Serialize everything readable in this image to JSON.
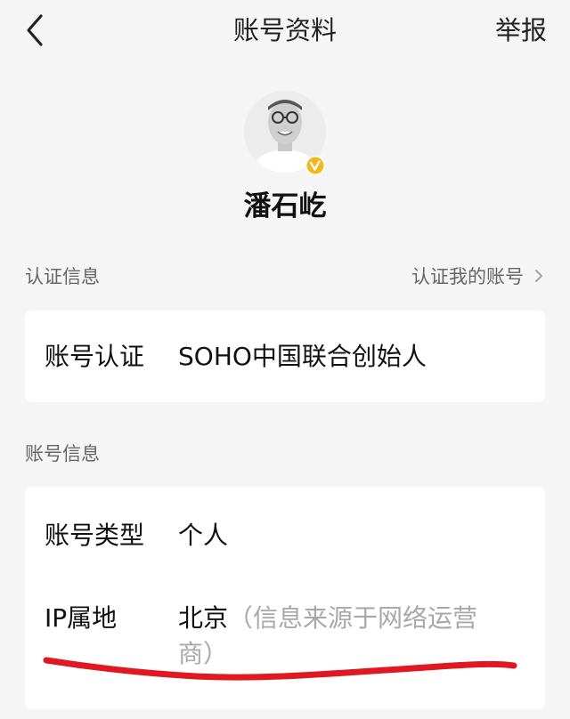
{
  "header": {
    "back_icon": "chevron-left-icon",
    "title": "账号资料",
    "report_label": "举报"
  },
  "profile": {
    "avatar_icon": "avatar",
    "badge_icon": "verified-v-icon",
    "badge_color": "#f2b81b",
    "name": "潘石屹"
  },
  "verification": {
    "section_label": "认证信息",
    "link_label": "认证我的账号",
    "link_icon": "chevron-right-icon",
    "row_label": "账号认证",
    "row_value": "SOHO中国联合创始人"
  },
  "account_info": {
    "section_label": "账号信息",
    "type_label": "账号类型",
    "type_value": "个人",
    "ip_label": "IP属地",
    "ip_value": "北京",
    "ip_note": "（信息来源于网络运营商）"
  },
  "colors": {
    "background": "#f5f5f5",
    "card": "#ffffff",
    "annotation_red": "#e01822"
  }
}
